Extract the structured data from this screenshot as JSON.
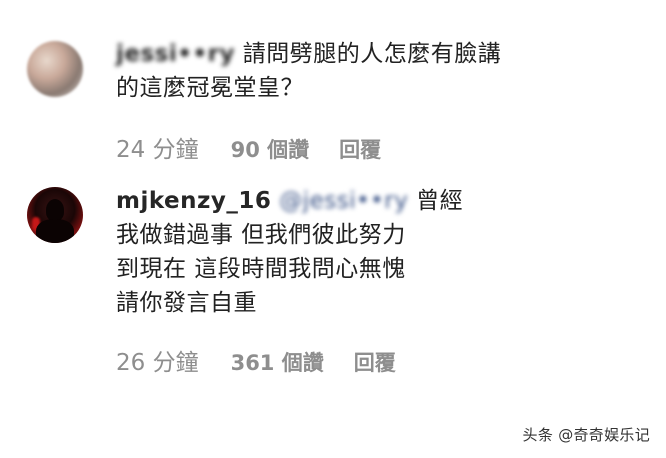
{
  "comments": [
    {
      "username": "jessi••ry",
      "text_line1": " 請問劈腿的人怎麼有臉講",
      "text_line2": "的這麼冠冕堂皇？",
      "time": "24 分鐘",
      "likes": "90 個讚",
      "reply": "回覆"
    },
    {
      "username": "mjkenzy_16",
      "mention": "@jessi••ry",
      "text_line1": " 曾經",
      "text_line2": "我做錯過事 但我們彼此努力",
      "text_line3": "到現在 這段時間我問心無愧",
      "text_line4": "請你發言自重",
      "time": "26 分鐘",
      "likes": "361 個讚",
      "reply": "回覆"
    }
  ],
  "watermark": "头条 @奇奇娱乐记"
}
